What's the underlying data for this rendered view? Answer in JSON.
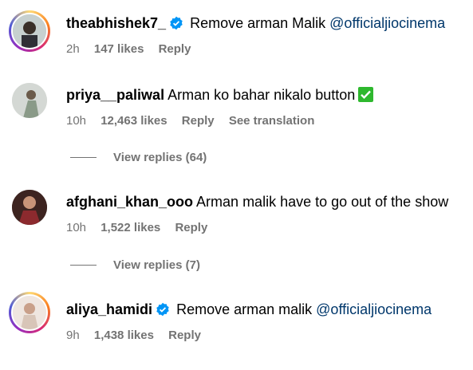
{
  "comments": [
    {
      "username": "theabhishek7_",
      "verified": true,
      "text": "Remove arman Malik",
      "mention": "@officialjiocinema",
      "time": "2h",
      "likes": "147 likes",
      "reply": "Reply",
      "avatar": "story-ring"
    },
    {
      "username": "priya__paliwal",
      "verified": false,
      "text": "Arman ko bahar nikalo button",
      "emoji": "check-mark-button",
      "time": "10h",
      "likes": "12,463 likes",
      "reply": "Reply",
      "translation": "See translation",
      "view_replies": "View replies (64)"
    },
    {
      "username": "afghani_khan_ooo",
      "verified": false,
      "text": "Arman malik have to go out of the show",
      "time": "10h",
      "likes": "1,522 likes",
      "reply": "Reply",
      "view_replies": "View replies (7)"
    },
    {
      "username": "aliya_hamidi",
      "verified": true,
      "text": "Remove arman malik",
      "mention": "@officialjiocinema",
      "time": "9h",
      "likes": "1,438 likes",
      "reply": "Reply",
      "avatar": "story-ring"
    }
  ],
  "colors": {
    "secondary_text": "#737373",
    "mention": "#00376b",
    "verified_badge": "#0095f6"
  }
}
